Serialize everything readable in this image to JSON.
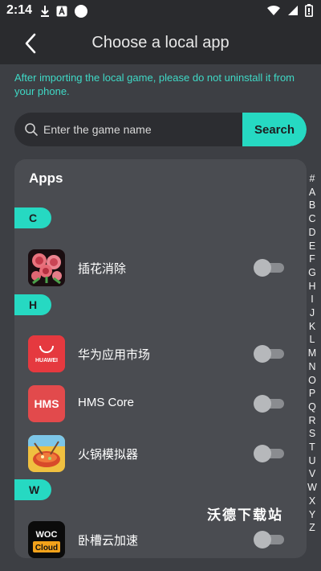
{
  "status_bar": {
    "time": "2:14",
    "icons_left": [
      "download-icon",
      "text-a-icon",
      "circle-dot-icon"
    ],
    "icons_right": [
      "wifi-icon",
      "signal-icon",
      "battery-icon"
    ]
  },
  "header": {
    "title": "Choose a local app"
  },
  "notice": "After importing the local game, please do not uninstall it from your phone.",
  "search": {
    "placeholder": "Enter the game name",
    "value": "",
    "button_label": "Search"
  },
  "apps": {
    "title": "Apps",
    "sections": [
      {
        "letter": "C",
        "items": [
          {
            "name": "插花消除",
            "enabled": false,
            "icon": "flower-app-icon"
          }
        ]
      },
      {
        "letter": "H",
        "items": [
          {
            "name": "华为应用市场",
            "enabled": false,
            "icon": "huawei-appgallery-icon",
            "icon_text": "HUAWEI"
          },
          {
            "name": "HMS Core",
            "enabled": false,
            "icon": "hms-core-icon",
            "icon_text": "HMS"
          },
          {
            "name": "火锅模拟器",
            "enabled": false,
            "icon": "hotpot-simulator-icon"
          }
        ]
      },
      {
        "letter": "W",
        "items": [
          {
            "name": "卧槽云加速",
            "enabled": false,
            "icon": "woc-cloud-icon",
            "icon_text_top": "WOC",
            "icon_text_bottom": "Cloud"
          }
        ]
      }
    ]
  },
  "alphabet_index": [
    "#",
    "A",
    "B",
    "C",
    "D",
    "E",
    "F",
    "G",
    "H",
    "I",
    "J",
    "K",
    "L",
    "M",
    "N",
    "O",
    "P",
    "Q",
    "R",
    "S",
    "T",
    "U",
    "V",
    "W",
    "X",
    "Y",
    "Z"
  ],
  "watermark": "沃德下载站",
  "colors": {
    "background": "#3d3f44",
    "header": "#2a2b2e",
    "accent": "#26d9c2",
    "card": "#4a4c51",
    "notice_text": "#3fd9c6"
  }
}
